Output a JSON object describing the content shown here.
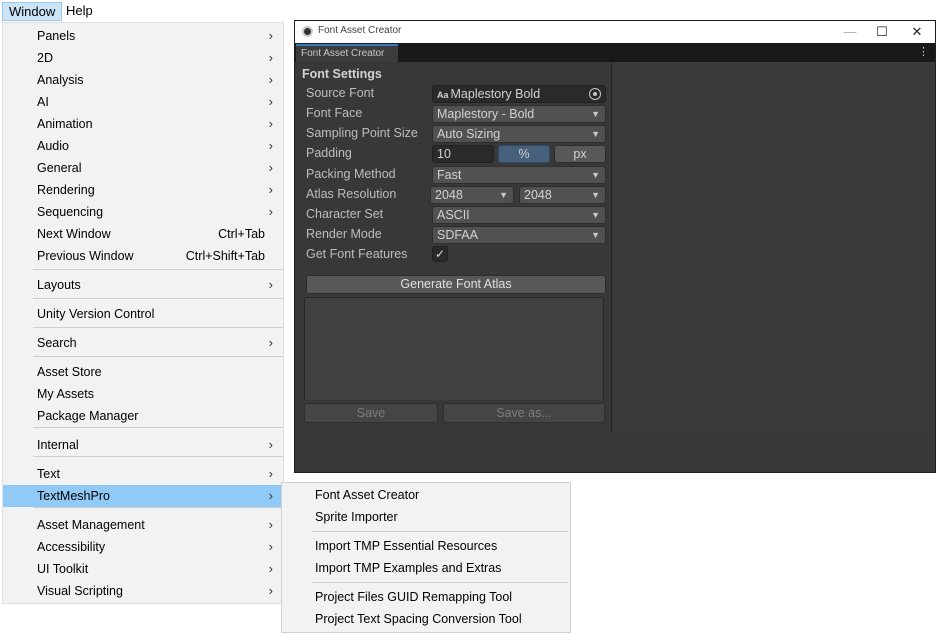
{
  "menubar": {
    "window": "Window",
    "help": "Help"
  },
  "window_menu": {
    "items": [
      {
        "label": "Panels",
        "shortcut": "",
        "submenu": true
      },
      {
        "label": "2D",
        "shortcut": "",
        "submenu": true
      },
      {
        "label": "Analysis",
        "shortcut": "",
        "submenu": true
      },
      {
        "label": "AI",
        "shortcut": "",
        "submenu": true
      },
      {
        "label": "Animation",
        "shortcut": "",
        "submenu": true
      },
      {
        "label": "Audio",
        "shortcut": "",
        "submenu": true
      },
      {
        "label": "General",
        "shortcut": "",
        "submenu": true
      },
      {
        "label": "Rendering",
        "shortcut": "",
        "submenu": true
      },
      {
        "label": "Sequencing",
        "shortcut": "",
        "submenu": true
      },
      {
        "label": "Next Window",
        "shortcut": "Ctrl+Tab",
        "submenu": false
      },
      {
        "label": "Previous Window",
        "shortcut": "Ctrl+Shift+Tab",
        "submenu": false
      },
      {
        "label": "Layouts",
        "shortcut": "",
        "submenu": true
      },
      {
        "label": "Unity Version Control",
        "shortcut": "",
        "submenu": false
      },
      {
        "label": "Search",
        "shortcut": "",
        "submenu": true
      },
      {
        "label": "Asset Store",
        "shortcut": "",
        "submenu": false
      },
      {
        "label": "My Assets",
        "shortcut": "",
        "submenu": false
      },
      {
        "label": "Package Manager",
        "shortcut": "",
        "submenu": false
      },
      {
        "label": "Internal",
        "shortcut": "",
        "submenu": true
      },
      {
        "label": "Text",
        "shortcut": "",
        "submenu": true
      },
      {
        "label": "TextMeshPro",
        "shortcut": "",
        "submenu": true
      },
      {
        "label": "Asset Management",
        "shortcut": "",
        "submenu": true
      },
      {
        "label": "Accessibility",
        "shortcut": "",
        "submenu": true
      },
      {
        "label": "UI Toolkit",
        "shortcut": "",
        "submenu": true
      },
      {
        "label": "Visual Scripting",
        "shortcut": "",
        "submenu": true
      }
    ],
    "highlighted": "TextMeshPro",
    "highlight_color": "#91c9f7"
  },
  "textmeshpro_submenu": {
    "items": [
      {
        "label": "Font Asset Creator"
      },
      {
        "label": "Sprite Importer"
      },
      {
        "label": "Import TMP Essential Resources"
      },
      {
        "label": "Import TMP Examples and Extras"
      },
      {
        "label": "Project Files GUID Remapping Tool"
      },
      {
        "label": "Project Text Spacing Conversion Tool"
      }
    ]
  },
  "font_asset_creator": {
    "window_title": "Font Asset Creator",
    "tab_label": "Font Asset Creator",
    "section_title": "Font Settings",
    "source_font": {
      "label": "Source Font",
      "value": "Maplestory Bold",
      "icon_text": "Aa"
    },
    "font_face": {
      "label": "Font Face",
      "value": "Maplestory - Bold"
    },
    "sampling_point_size": {
      "label": "Sampling Point Size",
      "value": "Auto Sizing"
    },
    "padding": {
      "label": "Padding",
      "value": "10",
      "percent_label": "%",
      "px_label": "px"
    },
    "packing_method": {
      "label": "Packing Method",
      "value": "Fast"
    },
    "atlas_resolution": {
      "label": "Atlas Resolution",
      "width": "2048",
      "height": "2048"
    },
    "character_set": {
      "label": "Character Set",
      "value": "ASCII"
    },
    "render_mode": {
      "label": "Render Mode",
      "value": "SDFAA"
    },
    "get_font_features": {
      "label": "Get Font Features",
      "checked": true,
      "check_glyph": "✓"
    },
    "generate_button": "Generate Font Atlas",
    "save_button": "Save",
    "save_as_button": "Save as...",
    "accent_color": "#3a79bb"
  }
}
